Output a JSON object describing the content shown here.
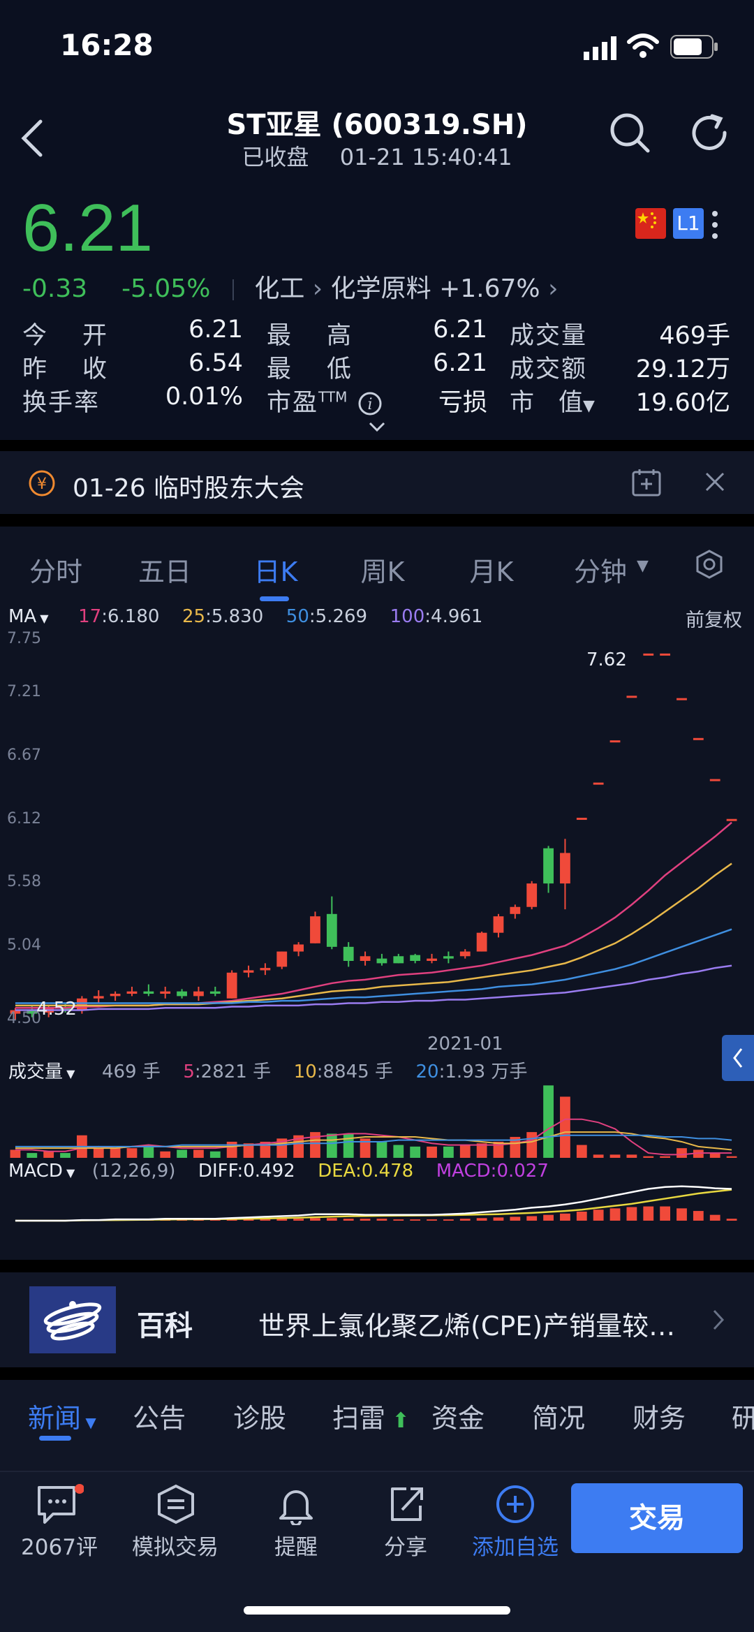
{
  "status_bar": {
    "time": "16:28"
  },
  "header": {
    "title": "ST亚星 (600319.SH)",
    "status": "已收盘",
    "datetime": "01-21 15:40:41"
  },
  "quote": {
    "price": "6.21",
    "change": "-0.33",
    "change_pct": "-5.05%",
    "sector": "化工",
    "industry": "化学原料",
    "industry_change": "+1.67%",
    "level_badge": "L1",
    "colors": {
      "down": "#3fbf5a",
      "up": "#f04a3a",
      "accent": "#3d7cf2"
    }
  },
  "stats": {
    "open_label": "今　开",
    "open": "6.21",
    "high_label": "最　高",
    "high": "6.21",
    "volume_label": "成交量",
    "volume": "469手",
    "prev_close_label": "昨　收",
    "prev_close": "6.54",
    "low_label": "最　低",
    "low": "6.21",
    "turnover_label": "成交额",
    "turnover": "29.12万",
    "turnover_rate_label": "换手率",
    "turnover_rate": "0.01%",
    "pe_label": "市盈",
    "pe_sup": "TTM",
    "pe": "亏损",
    "mcap_label": "市　值",
    "mcap": "19.60亿"
  },
  "notice": {
    "text": "01-26 临时股东大会"
  },
  "chart_tabs": {
    "items": [
      "分时",
      "五日",
      "日K",
      "周K",
      "月K",
      "分钟"
    ],
    "active": "日K"
  },
  "ma_legend": {
    "label": "MA",
    "ma17": "17",
    "ma17_val": ":6.180",
    "ma25": "25",
    "ma25_val": ":5.830",
    "ma50": "50",
    "ma50_val": ":5.269",
    "ma100": "100",
    "ma100_val": ":4.961",
    "adjust": "前复权"
  },
  "volume_legend": {
    "label": "成交量",
    "current": "469 手",
    "v5": "5",
    "v5_val": ":2821 手",
    "v10": "10",
    "v10_val": ":8845 手",
    "v20": "20",
    "v20_val": ":1.93 万手"
  },
  "macd_legend": {
    "label": "MACD",
    "params": "(12,26,9)",
    "diff": "DIFF:0.492",
    "dea": "DEA:0.478",
    "macd": "MACD:0.027"
  },
  "chart_data": {
    "type": "candlestick",
    "y_ticks": [
      "7.75",
      "7.21",
      "6.67",
      "6.12",
      "5.58",
      "5.04",
      "4.50"
    ],
    "ylim": [
      4.5,
      7.75
    ],
    "x_tick": "2021-01",
    "max_label": "7.62",
    "min_label": "4.52",
    "candles": [
      [
        4.55,
        4.6,
        4.5,
        4.58
      ],
      [
        4.58,
        4.62,
        4.52,
        4.55
      ],
      [
        4.56,
        4.62,
        4.52,
        4.6
      ],
      [
        4.6,
        4.64,
        4.56,
        4.58
      ],
      [
        4.58,
        4.7,
        4.55,
        4.68
      ],
      [
        4.68,
        4.75,
        4.64,
        4.7
      ],
      [
        4.7,
        4.74,
        4.66,
        4.72
      ],
      [
        4.72,
        4.78,
        4.7,
        4.74
      ],
      [
        4.74,
        4.8,
        4.7,
        4.72
      ],
      [
        4.72,
        4.78,
        4.68,
        4.74
      ],
      [
        4.74,
        4.76,
        4.68,
        4.7
      ],
      [
        4.7,
        4.78,
        4.66,
        4.74
      ],
      [
        4.74,
        4.78,
        4.7,
        4.72
      ],
      [
        4.68,
        4.92,
        4.68,
        4.9
      ],
      [
        4.9,
        4.96,
        4.86,
        4.92
      ],
      [
        4.92,
        4.98,
        4.88,
        4.94
      ],
      [
        4.95,
        5.08,
        4.93,
        5.08
      ],
      [
        5.08,
        5.16,
        5.04,
        5.14
      ],
      [
        5.15,
        5.42,
        5.15,
        5.38
      ],
      [
        5.4,
        5.55,
        5.1,
        5.12
      ],
      [
        5.12,
        5.16,
        4.95,
        5.0
      ],
      [
        5.0,
        5.08,
        4.96,
        5.04
      ],
      [
        5.02,
        5.06,
        4.96,
        4.98
      ],
      [
        5.04,
        5.06,
        4.98,
        4.98
      ],
      [
        5.05,
        5.06,
        4.98,
        5.0
      ],
      [
        5.0,
        5.06,
        4.98,
        5.02
      ],
      [
        5.04,
        5.08,
        4.98,
        5.02
      ],
      [
        5.04,
        5.1,
        5.02,
        5.08
      ],
      [
        5.08,
        5.25,
        5.08,
        5.24
      ],
      [
        5.24,
        5.4,
        5.2,
        5.38
      ],
      [
        5.4,
        5.48,
        5.36,
        5.46
      ],
      [
        5.46,
        5.68,
        5.44,
        5.66
      ],
      [
        5.96,
        5.98,
        5.58,
        5.66
      ],
      [
        5.66,
        6.04,
        5.44,
        5.92
      ],
      [
        6.22,
        6.22,
        6.22,
        6.22
      ],
      [
        6.52,
        6.52,
        6.52,
        6.52
      ],
      [
        6.88,
        6.88,
        6.88,
        6.88
      ],
      [
        7.26,
        7.26,
        7.26,
        7.26
      ],
      [
        7.62,
        7.62,
        7.62,
        7.62
      ],
      [
        7.62,
        7.62,
        7.62,
        7.62
      ],
      [
        7.24,
        7.24,
        7.24,
        7.24
      ],
      [
        6.9,
        6.9,
        6.9,
        6.9
      ],
      [
        6.55,
        6.55,
        6.55,
        6.55
      ],
      [
        6.21,
        6.21,
        6.21,
        6.21
      ]
    ],
    "ma": {
      "ma17": [
        4.6,
        4.6,
        4.6,
        4.6,
        4.61,
        4.61,
        4.62,
        4.62,
        4.62,
        4.63,
        4.63,
        4.64,
        4.65,
        4.66,
        4.68,
        4.7,
        4.72,
        4.75,
        4.78,
        4.81,
        4.83,
        4.84,
        4.86,
        4.88,
        4.89,
        4.9,
        4.92,
        4.94,
        4.96,
        4.99,
        5.02,
        5.05,
        5.09,
        5.13,
        5.2,
        5.28,
        5.37,
        5.48,
        5.6,
        5.73,
        5.84,
        5.95,
        6.06,
        6.18
      ],
      "ma25": [
        4.62,
        4.62,
        4.62,
        4.62,
        4.62,
        4.62,
        4.62,
        4.62,
        4.62,
        4.63,
        4.63,
        4.63,
        4.64,
        4.65,
        4.66,
        4.67,
        4.68,
        4.7,
        4.72,
        4.74,
        4.75,
        4.76,
        4.78,
        4.79,
        4.8,
        4.81,
        4.82,
        4.84,
        4.86,
        4.88,
        4.9,
        4.92,
        4.95,
        4.98,
        5.03,
        5.09,
        5.15,
        5.23,
        5.32,
        5.42,
        5.52,
        5.62,
        5.73,
        5.83
      ],
      "ma50": [
        4.64,
        4.64,
        4.64,
        4.64,
        4.64,
        4.64,
        4.64,
        4.64,
        4.64,
        4.64,
        4.64,
        4.64,
        4.64,
        4.64,
        4.65,
        4.65,
        4.66,
        4.66,
        4.67,
        4.68,
        4.69,
        4.69,
        4.7,
        4.71,
        4.72,
        4.73,
        4.74,
        4.75,
        4.76,
        4.78,
        4.79,
        4.8,
        4.82,
        4.84,
        4.87,
        4.9,
        4.93,
        4.97,
        5.02,
        5.07,
        5.12,
        5.17,
        5.22,
        5.27
      ],
      "ma100": [
        4.58,
        4.58,
        4.58,
        4.58,
        4.58,
        4.59,
        4.59,
        4.59,
        4.59,
        4.6,
        4.6,
        4.6,
        4.6,
        4.61,
        4.61,
        4.62,
        4.62,
        4.62,
        4.63,
        4.63,
        4.64,
        4.64,
        4.65,
        4.65,
        4.66,
        4.66,
        4.67,
        4.67,
        4.68,
        4.69,
        4.7,
        4.71,
        4.72,
        4.73,
        4.75,
        4.77,
        4.79,
        4.81,
        4.84,
        4.86,
        4.89,
        4.91,
        4.94,
        4.96
      ]
    },
    "ma_colors": {
      "ma17": "#e0407f",
      "ma25": "#e8b84a",
      "ma50": "#3f8fe0",
      "ma100": "#9a7cf0"
    },
    "volume": [
      5,
      3,
      4,
      3,
      14,
      6,
      6,
      6,
      8,
      4,
      5,
      5,
      4,
      10,
      9,
      10,
      12,
      14,
      16,
      15,
      15,
      12,
      10,
      8,
      7,
      7,
      7,
      8,
      9,
      10,
      13,
      16,
      45,
      38,
      8,
      2,
      2,
      2,
      1,
      1,
      6,
      5,
      3,
      1
    ],
    "volume_ma": {
      "v5": [
        5,
        5,
        4,
        4,
        6,
        7,
        6,
        7,
        8,
        7,
        6,
        6,
        6,
        7,
        8,
        9,
        10,
        12,
        13,
        14,
        15,
        15,
        14,
        13,
        11,
        9,
        8,
        8,
        8,
        8,
        9,
        11,
        18,
        24,
        24,
        22,
        18,
        10,
        3,
        2,
        2,
        3,
        3,
        3
      ],
      "v10": [
        6,
        6,
        6,
        6,
        6,
        6,
        6,
        7,
        7,
        7,
        7,
        7,
        7,
        7,
        8,
        8,
        9,
        10,
        11,
        11,
        12,
        13,
        13,
        13,
        13,
        12,
        11,
        11,
        10,
        9,
        9,
        10,
        13,
        16,
        16,
        16,
        16,
        15,
        13,
        12,
        10,
        7,
        6,
        5
      ],
      "v20": [
        7,
        7,
        7,
        7,
        7,
        7,
        7,
        7,
        7,
        7,
        8,
        8,
        8,
        8,
        8,
        8,
        8,
        9,
        9,
        9,
        10,
        10,
        10,
        11,
        11,
        11,
        11,
        11,
        11,
        11,
        11,
        12,
        13,
        14,
        14,
        14,
        14,
        14,
        14,
        13,
        13,
        12,
        12,
        11
      ]
    },
    "macd": [
      0,
      0,
      0,
      0,
      0.01,
      0.01,
      0.01,
      0.01,
      0.01,
      0.01,
      0.01,
      0.01,
      0.01,
      0.02,
      0.02,
      0.02,
      0.03,
      0.03,
      0.04,
      0.04,
      0.03,
      0.03,
      0.03,
      0.02,
      0.02,
      0.02,
      0.02,
      0.03,
      0.04,
      0.05,
      0.06,
      0.07,
      0.09,
      0.11,
      0.14,
      0.17,
      0.19,
      0.21,
      0.22,
      0.22,
      0.19,
      0.15,
      0.09,
      0.03
    ],
    "diff": [
      0,
      0,
      0,
      0,
      0.01,
      0.01,
      0.02,
      0.02,
      0.02,
      0.03,
      0.03,
      0.03,
      0.03,
      0.04,
      0.05,
      0.06,
      0.07,
      0.08,
      0.1,
      0.1,
      0.1,
      0.09,
      0.09,
      0.09,
      0.09,
      0.09,
      0.1,
      0.11,
      0.13,
      0.15,
      0.17,
      0.2,
      0.22,
      0.25,
      0.29,
      0.34,
      0.39,
      0.44,
      0.49,
      0.52,
      0.53,
      0.52,
      0.5,
      0.49
    ],
    "dea": [
      0,
      0,
      0,
      0,
      0.005,
      0.008,
      0.01,
      0.012,
      0.015,
      0.018,
      0.02,
      0.022,
      0.024,
      0.026,
      0.03,
      0.034,
      0.04,
      0.046,
      0.054,
      0.062,
      0.068,
      0.072,
      0.075,
      0.078,
      0.08,
      0.082,
      0.085,
      0.09,
      0.095,
      0.1,
      0.11,
      0.12,
      0.135,
      0.15,
      0.17,
      0.2,
      0.23,
      0.26,
      0.3,
      0.34,
      0.38,
      0.42,
      0.45,
      0.478
    ]
  },
  "baike": {
    "label": "百科",
    "text": "世界上氯化聚乙烯(CPE)产销量较…"
  },
  "news_tabs": {
    "items": [
      "新闻",
      "公告",
      "诊股",
      "扫雷",
      "资金",
      "简况",
      "财务",
      "研"
    ],
    "active": "新闻"
  },
  "bottom_nav": {
    "comments": "2067评",
    "sim_trade": "模拟交易",
    "alert": "提醒",
    "share": "分享",
    "add_watch": "添加自选",
    "trade": "交易"
  }
}
